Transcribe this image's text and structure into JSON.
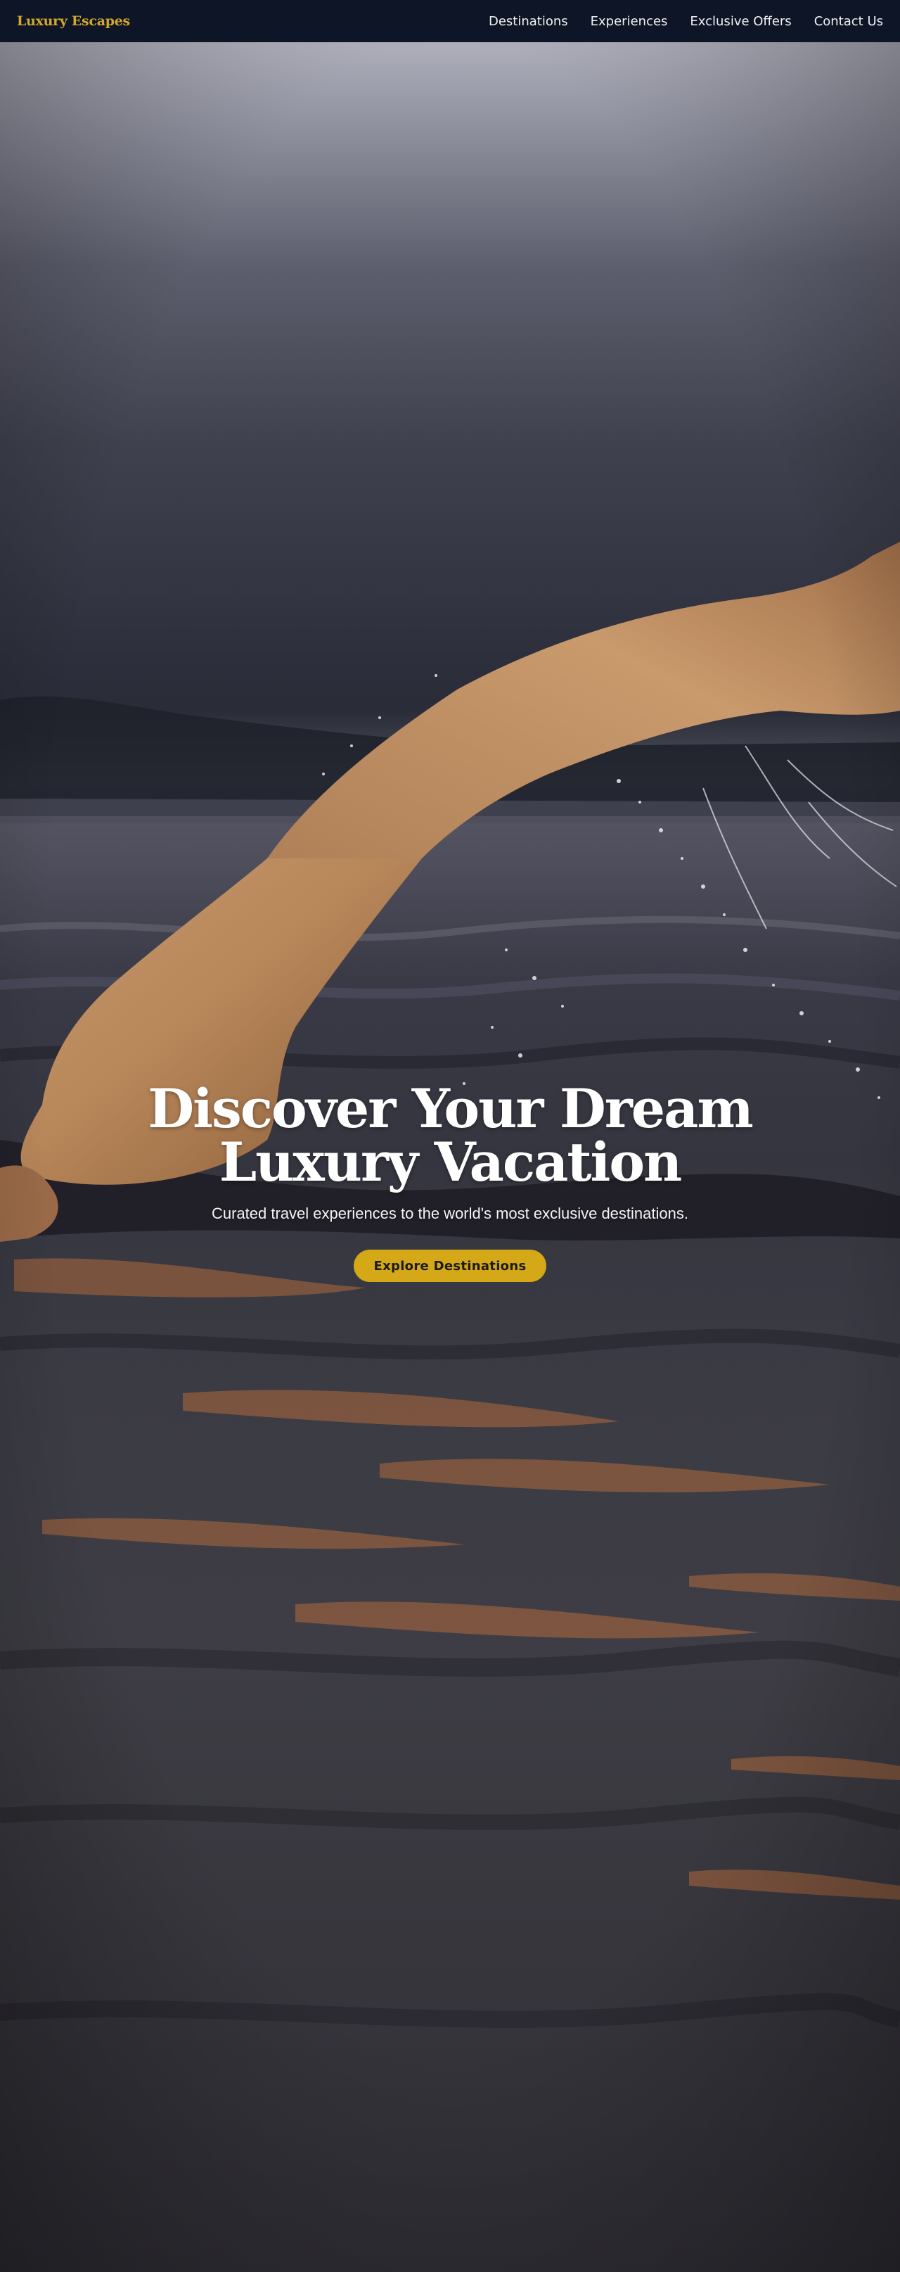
{
  "header": {
    "logo": "Luxury Escapes",
    "nav": [
      {
        "label": "Destinations"
      },
      {
        "label": "Experiences"
      },
      {
        "label": "Exclusive Offers"
      },
      {
        "label": "Contact Us"
      }
    ]
  },
  "hero": {
    "title": "Discover Your Dream Luxury Vacation",
    "subtitle": "Curated travel experiences to the world's most exclusive destinations.",
    "cta_label": "Explore Destinations",
    "background": "swimmer-in-water-photo"
  },
  "colors": {
    "header_bg": "#0d1526",
    "brand_gold": "#d4a82a",
    "cta_bg": "#d4a816"
  }
}
